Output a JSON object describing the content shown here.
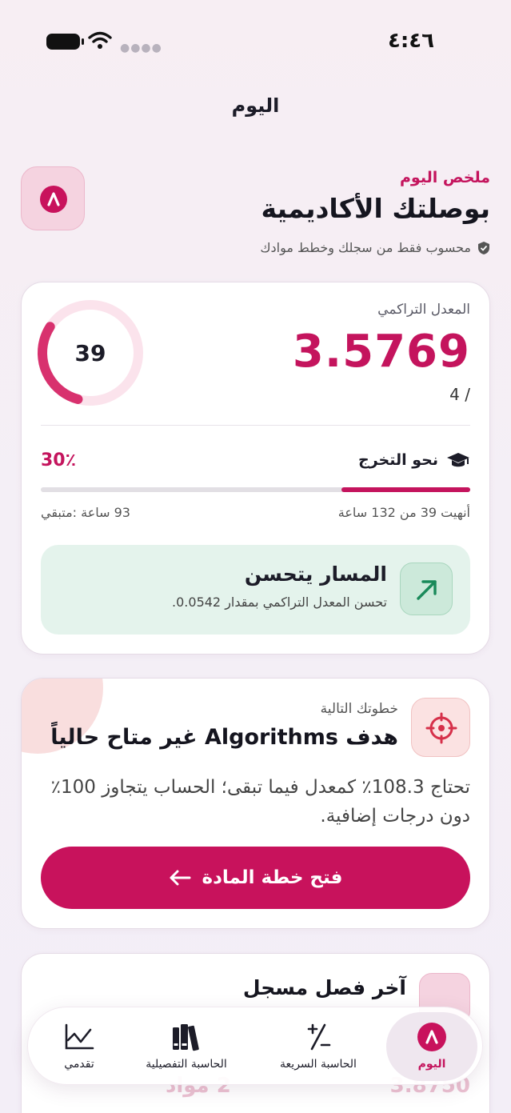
{
  "status_bar": {
    "time": "٤:٤٦"
  },
  "nav": {
    "title": "اليوم"
  },
  "header": {
    "kicker": "ملخص اليوم",
    "title": "بوصلتك الأكاديمية",
    "note": "محسوب فقط من سجلك وخطط موادك"
  },
  "gpa_card": {
    "label": "المعدل التراكمي",
    "value": "3.5769",
    "scale": "4 /",
    "ring_value": "39",
    "graduation_label": "نحو التخرج",
    "graduation_percent": "30٪",
    "graduation_progress": 0.3,
    "hours_done": "أنهيت 39 من 132 ساعة",
    "hours_left": "93 ساعة :متبقي",
    "trend_title": "المسار يتحسن",
    "trend_desc": "تحسن المعدل التراكمي بمقدار 0.0542."
  },
  "next_step_card": {
    "kicker": "خطوتك التالية",
    "title": "هدف Algorithms غير متاح حالياً",
    "description": "تحتاج 108.3٪ كمعدل فيما تبقى؛ الحساب يتجاوز 100٪ دون درجات إضافية.",
    "button_label": "فتح خطة المادة"
  },
  "last_term_card": {
    "title": "آخر فصل مسجل",
    "courses": "2 مواد",
    "gpa": "3.8750"
  },
  "tab_bar": {
    "today": "اليوم",
    "quick_calc": "الحاسبة السريعة",
    "detailed_calc": "الحاسبة التفصيلية",
    "progress": "تقدمي"
  },
  "colors": {
    "accent": "#c4145d",
    "trend_bg": "#e4f3ec",
    "trend_icon": "#1a8a5a",
    "target_icon": "#d6304a"
  }
}
